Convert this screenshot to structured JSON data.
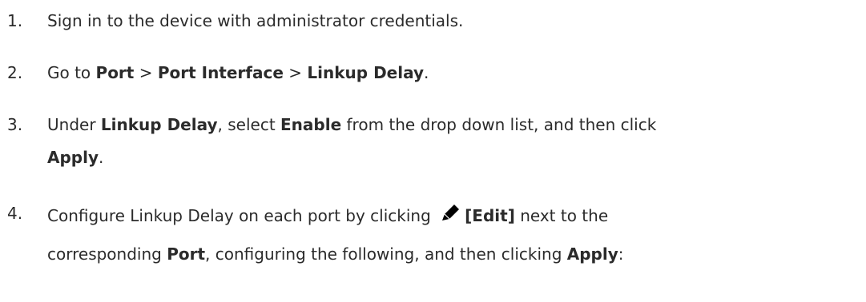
{
  "steps": [
    {
      "number": "1.",
      "text": "Sign in to the device with administrator credentials."
    },
    {
      "number": "2.",
      "t1": "Go to ",
      "b1": "Port",
      "t2": " > ",
      "b2": "Port Interface",
      "t3": " > ",
      "b3": "Linkup Delay",
      "t4": "."
    },
    {
      "number": "3.",
      "t1": "Under ",
      "b1": "Linkup Delay",
      "t2": ", select ",
      "b2": "Enable",
      "t3": " from the drop down list, and then click",
      "b3": "Apply",
      "t4": "."
    },
    {
      "number": "4.",
      "t1": "Configure Linkup Delay on each port by clicking ",
      "icon": "pencil-edit-icon",
      "b1": "[Edit]",
      "t2": " next to the",
      "t3": "corresponding ",
      "b2": "Port",
      "t4": ", configuring the following, and then clicking ",
      "b3": "Apply",
      "t5": ":"
    }
  ]
}
